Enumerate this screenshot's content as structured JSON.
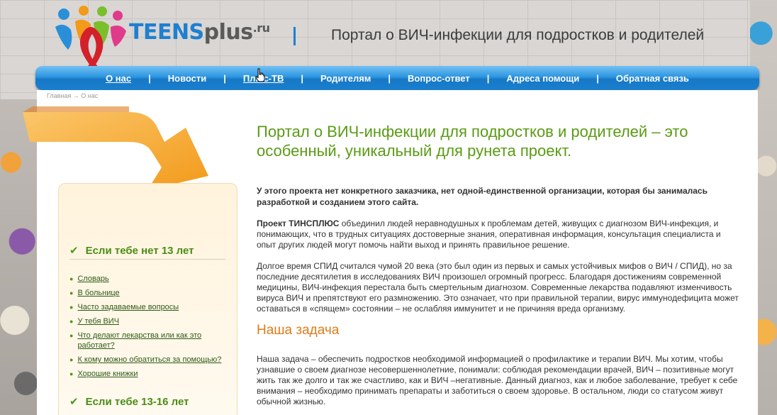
{
  "header": {
    "logo_teens": "TEENS",
    "logo_plus": "plus",
    "logo_ru": ".ru",
    "tagline": "Портал о ВИЧ-инфекции для подростков и родителей"
  },
  "nav": {
    "items": [
      {
        "label": "О нас"
      },
      {
        "label": "Новости"
      },
      {
        "label": "Плюс-ТВ"
      },
      {
        "label": "Родителям"
      },
      {
        "label": "Вопрос-ответ"
      },
      {
        "label": "Адреса помощи"
      },
      {
        "label": "Обратная связь"
      }
    ],
    "separator": "|"
  },
  "breadcrumb": "Главная → О нас",
  "sidebar": {
    "section1": {
      "title": "Если тебе нет 13 лет",
      "links": [
        "Словарь",
        "В больнице",
        "Часто задаваемые вопросы",
        "У тебя ВИЧ",
        "Что делают лекарства или как это работает?",
        "К кому можно обратиться за помощью?",
        "Хорошие книжки"
      ]
    },
    "section2": {
      "title": "Если тебе 13-16 лет"
    }
  },
  "content": {
    "headline": "Портал о ВИЧ-инфекции для подростков и родителей – это особенный, уникальный для рунета проект.",
    "intro": "У этого проекта нет конкретного заказчика, нет одной-единственной организации, которая бы занималась разработкой и созданием этого сайта.",
    "p1_bold": "Проект ТИНСПЛЮС",
    "p1_rest": " объединил людей неравнодушных к проблемам детей, живущих с диагнозом ВИЧ-инфекция, и понимающих, что в трудных ситуациях достоверные знания, оперативная информация, консультация специалиста и опыт других людей могут помочь найти выход и принять правильное решение.",
    "p2": "Долгое время СПИД считался чумой 20 века (это был один из первых и самых устойчивых мифов о ВИЧ / СПИД), но за последние десятилетия  в исследованиях ВИЧ произошел огромный прогресс. Благодаря достижениям современной медицины, ВИЧ-инфекция перестала быть смертельным диагнозом. Современные лекарства подавляют изменчивость вируса ВИЧ и препятствуют его размножению. Это означает, что при правильной терапии, вирус иммунодефицита может оставаться в «спящем» состоянии – не ослабляя иммунитет и не причиняя вреда организму.",
    "subheading": "Наша задача",
    "p3": "Наша задача – обеспечить подростков необходимой информацией о профилактике и терапии ВИЧ. Мы хотим, чтобы узнавшие о своем диагнозе несовершеннолетние, понимали: соблюдая рекомендации врачей,  ВИЧ – позитивные могут жить так же долго и так же счастливо, как и ВИЧ –негативные. Данный диагноз, как и любое заболевание, требует к себе внимания – необходимо принимать препараты и заботиться о своем здоровье. В остальном, люди со статусом живут обычной жизнью."
  },
  "colors": {
    "nav_blue": "#1f7fd0",
    "headline_green": "#5a9b14",
    "subheading_orange": "#e07b1a",
    "ribbon_red": "#d4202a"
  }
}
